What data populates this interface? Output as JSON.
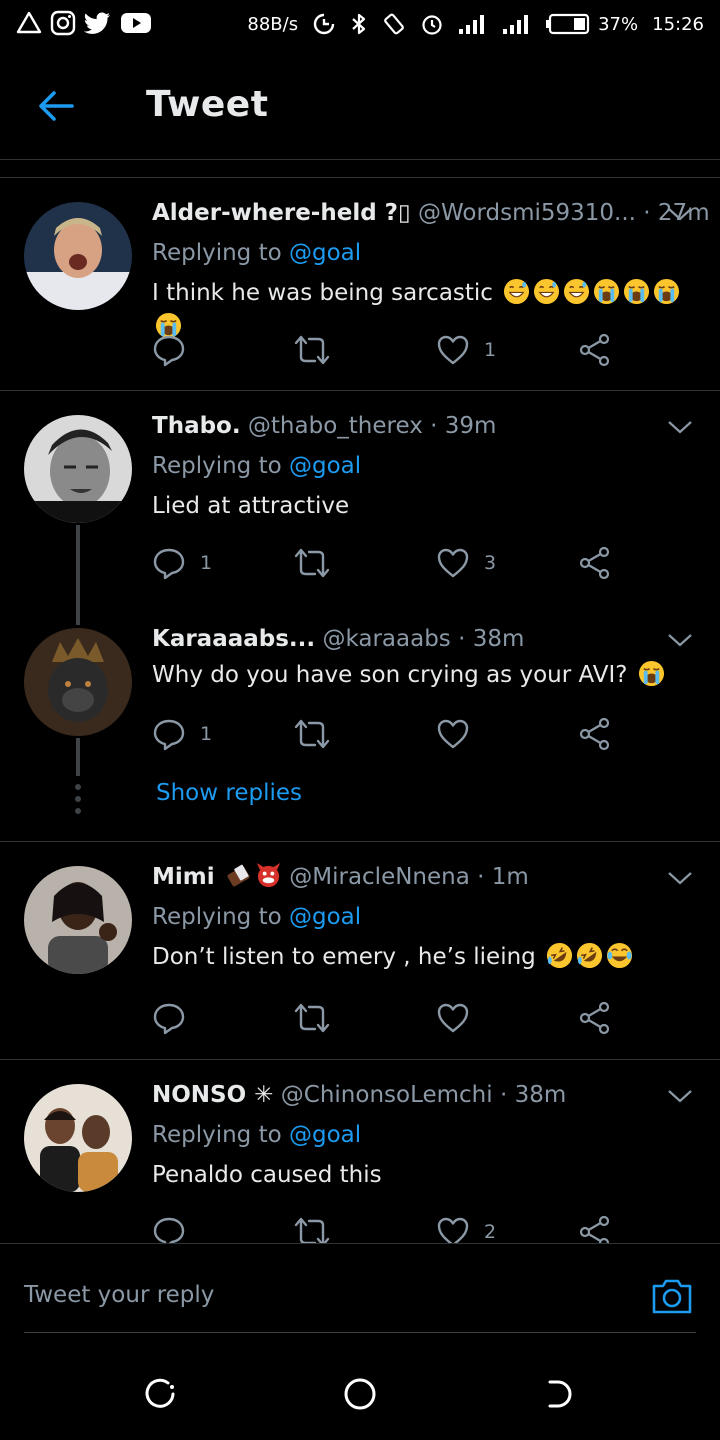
{
  "status_bar": {
    "net_speed": "88B/s",
    "battery_pct": "37%",
    "clock": "15:26"
  },
  "header": {
    "title": "Tweet",
    "back_icon": "arrow-left-icon"
  },
  "colors": {
    "accent": "#1d9bf0",
    "text_primary": "#e7e9ea",
    "text_secondary": "#8b98a5",
    "divider": "#2f3336",
    "background": "#000000"
  },
  "tweets": [
    {
      "name": "Alder-where-held ?▯",
      "handle": "@Wordsmi59310...",
      "time": "27m",
      "replying_prefix": "Replying to",
      "replying_to": "@goal",
      "text": "I think he was being sarcastic",
      "emojis": [
        "sweat-smile",
        "sweat-smile",
        "sweat-smile",
        "crying",
        "crying",
        "crying",
        "crying"
      ],
      "reply_count": "",
      "like_count": "1"
    },
    {
      "name": "Thabo.",
      "handle": "@thabo_therex",
      "time": "39m",
      "replying_prefix": "Replying to",
      "replying_to": "@goal",
      "text": "Lied at attractive",
      "emojis": [],
      "reply_count": "1",
      "like_count": "3"
    },
    {
      "name": "Karaaaabs...",
      "handle": "@karaaabs",
      "time": "38m",
      "text": "Why do you have son crying as your AVI?",
      "emojis": [
        "crying"
      ],
      "reply_count": "1",
      "like_count": ""
    },
    {
      "name": "Mimi",
      "name_emojis": [
        "chocolate-bar",
        "ogre"
      ],
      "handle": "@MiracleNnena",
      "time": "1m",
      "replying_prefix": "Replying to",
      "replying_to": "@goal",
      "text": "Don’t listen to emery , he’s lieing",
      "emojis": [
        "rofl",
        "rofl",
        "joy"
      ],
      "reply_count": "",
      "like_count": ""
    },
    {
      "name": "NONSO ✳",
      "handle": "@ChinonsoLemchi",
      "time": "38m",
      "replying_prefix": "Replying to",
      "replying_to": "@goal",
      "text": "Penaldo caused this",
      "emojis": [],
      "reply_count": "",
      "like_count": "2"
    }
  ],
  "thread": {
    "show_replies": "Show replies"
  },
  "composer": {
    "placeholder": "Tweet your reply",
    "camera_icon": "camera-icon"
  },
  "nav": {
    "recents_icon": "recents-icon",
    "home_icon": "home-circle-icon",
    "back_icon": "nav-back-icon"
  }
}
